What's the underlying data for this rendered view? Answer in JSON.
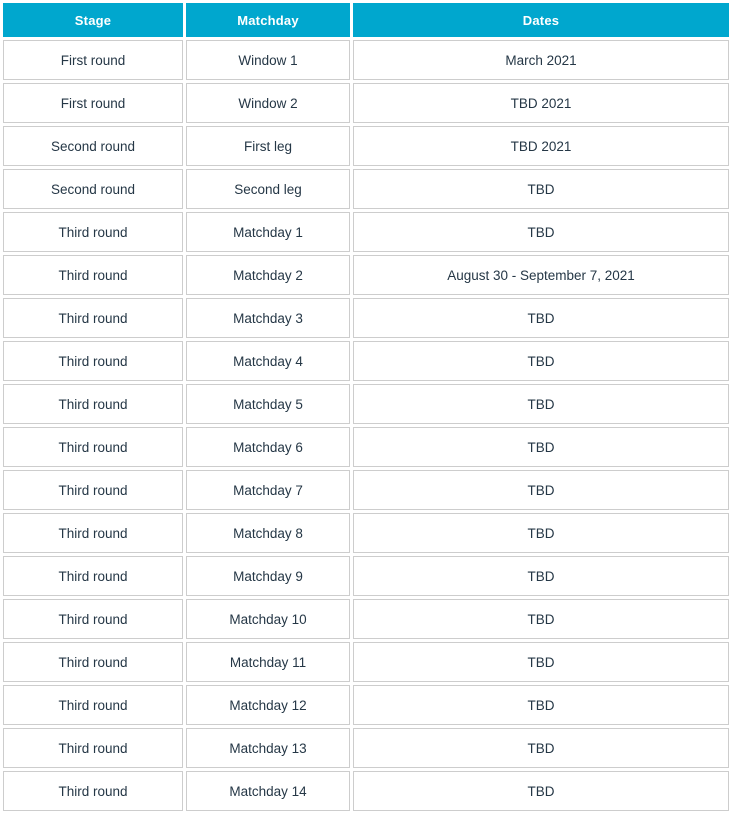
{
  "table": {
    "columns": [
      {
        "key": "stage",
        "label": "Stage"
      },
      {
        "key": "matchday",
        "label": "Matchday"
      },
      {
        "key": "dates",
        "label": "Dates"
      }
    ],
    "header_background": "#00a7ce",
    "header_text_color": "#ffffff",
    "cell_text_color": "#253746",
    "cell_border_color": "#cdcdcd",
    "rows": [
      {
        "stage": "First round",
        "matchday": "Window 1",
        "dates": "March 2021"
      },
      {
        "stage": "First round",
        "matchday": "Window 2",
        "dates": "TBD 2021"
      },
      {
        "stage": "Second round",
        "matchday": "First leg",
        "dates": "TBD 2021"
      },
      {
        "stage": "Second round",
        "matchday": "Second leg",
        "dates": "TBD"
      },
      {
        "stage": "Third round",
        "matchday": "Matchday 1",
        "dates": "TBD"
      },
      {
        "stage": "Third round",
        "matchday": "Matchday 2",
        "dates": "August 30 - September 7, 2021"
      },
      {
        "stage": "Third round",
        "matchday": "Matchday 3",
        "dates": "TBD"
      },
      {
        "stage": "Third round",
        "matchday": "Matchday 4",
        "dates": "TBD"
      },
      {
        "stage": "Third round",
        "matchday": "Matchday 5",
        "dates": "TBD"
      },
      {
        "stage": "Third round",
        "matchday": "Matchday 6",
        "dates": "TBD"
      },
      {
        "stage": "Third round",
        "matchday": "Matchday 7",
        "dates": "TBD"
      },
      {
        "stage": "Third round",
        "matchday": "Matchday 8",
        "dates": "TBD"
      },
      {
        "stage": "Third round",
        "matchday": "Matchday 9",
        "dates": "TBD"
      },
      {
        "stage": "Third round",
        "matchday": "Matchday 10",
        "dates": "TBD"
      },
      {
        "stage": "Third round",
        "matchday": "Matchday 11",
        "dates": "TBD"
      },
      {
        "stage": "Third round",
        "matchday": "Matchday 12",
        "dates": "TBD"
      },
      {
        "stage": "Third round",
        "matchday": "Matchday 13",
        "dates": "TBD"
      },
      {
        "stage": "Third round",
        "matchday": "Matchday 14",
        "dates": "TBD"
      }
    ]
  }
}
